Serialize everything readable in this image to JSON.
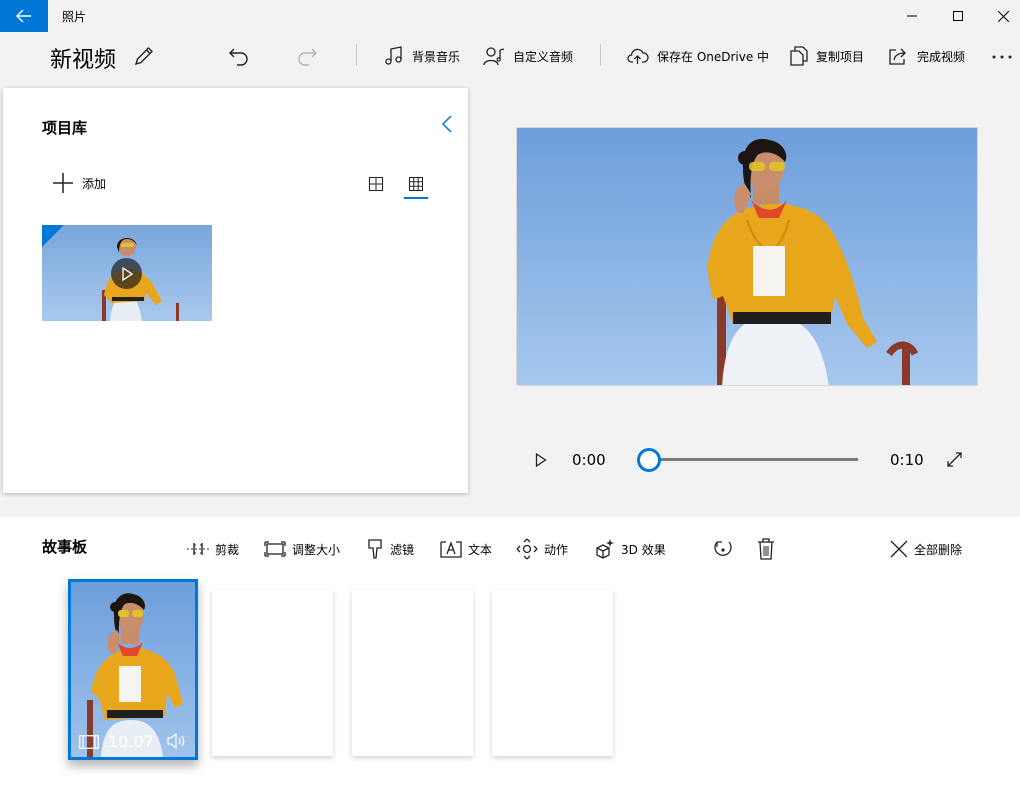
{
  "window": {
    "app_title": "照片",
    "icons": {
      "back": "back-arrow-icon",
      "minimize": "minimize-icon",
      "maximize": "maximize-icon",
      "close": "close-icon"
    }
  },
  "project": {
    "title": "新视频",
    "rename_icon": "pencil-icon"
  },
  "toolbar": {
    "undo_icon": "undo-icon",
    "redo_icon": "redo-icon",
    "background_music": "背景音乐",
    "custom_audio": "自定义音频",
    "save_onedrive": "保存在 OneDrive 中",
    "duplicate": "复制项目",
    "finish_video": "完成视频",
    "more_icon": "more-icon"
  },
  "library": {
    "title": "项目库",
    "add_label": "添加",
    "collapse_icon": "chevron-left-icon",
    "view_large_icon": "large-grid-icon",
    "view_small_icon": "small-grid-icon",
    "selected_view": "small-grid"
  },
  "player": {
    "current_time": "0:00",
    "total_time": "0:10",
    "progress": 0,
    "play_icon": "play-icon",
    "fullscreen_icon": "fullscreen-icon"
  },
  "storyboard": {
    "title": "故事板",
    "tools": [
      {
        "label": "剪裁",
        "icon": "trim-icon"
      },
      {
        "label": "调整大小",
        "icon": "resize-icon"
      },
      {
        "label": "滤镜",
        "icon": "filter-icon"
      },
      {
        "label": "文本",
        "icon": "text-icon"
      },
      {
        "label": "动作",
        "icon": "motion-icon"
      },
      {
        "label": "3D 效果",
        "icon": "3d-effects-icon"
      }
    ],
    "rotate_icon": "rotate-icon",
    "delete_icon": "trash-icon",
    "remove_all": "全部删除",
    "clip": {
      "duration": "10.07",
      "icon": "film-icon",
      "audio_icon": "volume-icon"
    }
  },
  "colors": {
    "accent": "#0078d7",
    "sky": "#6f9fd6",
    "jacket": "#e8a61c"
  }
}
